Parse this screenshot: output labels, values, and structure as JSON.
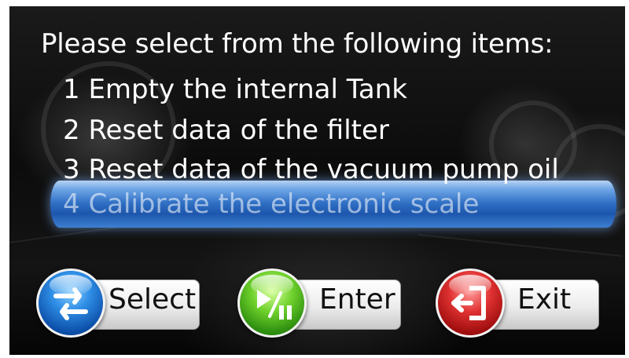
{
  "heading": "Please select from the following items:",
  "menu": {
    "items": [
      {
        "label": "1 Empty the internal Tank"
      },
      {
        "label": "2 Reset data of the filter"
      },
      {
        "label": "3 Reset data of the vacuum pump oil"
      },
      {
        "label": "4 Calibrate the electronic scale"
      }
    ],
    "selected_index": 3,
    "highlight_color": "#2f6fc4"
  },
  "buttons": {
    "select": {
      "label": "Select",
      "icon": "swap-arrows-icon",
      "color": "#2f8ee6"
    },
    "enter": {
      "label": "Enter",
      "icon": "play-pause-icon",
      "color": "#6fd12c"
    },
    "exit": {
      "label": "Exit",
      "icon": "exit-door-icon",
      "color": "#e03131"
    }
  }
}
